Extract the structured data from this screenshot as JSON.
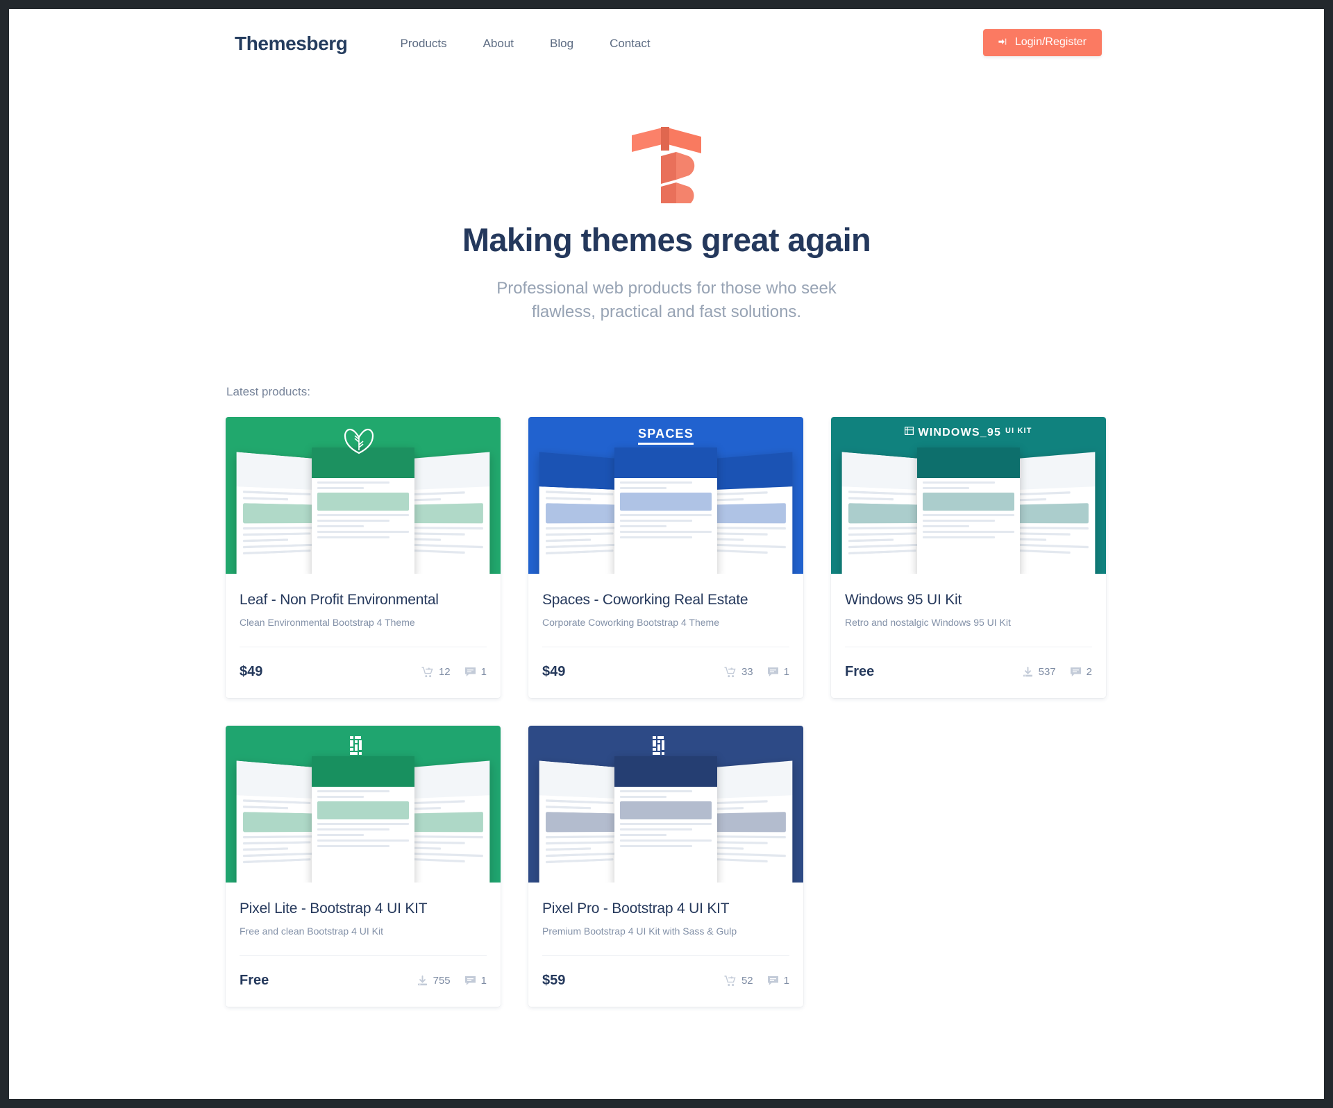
{
  "theme": {
    "accent": "#fb7a62",
    "navy": "#24385c",
    "muted": "#97a3b4",
    "page_border": "#23282d"
  },
  "navbar": {
    "brand": "Themesberg",
    "links": [
      {
        "label": "Products"
      },
      {
        "label": "About"
      },
      {
        "label": "Blog"
      },
      {
        "label": "Contact"
      }
    ],
    "login_label": "Login/Register",
    "login_icon": "sign-in-icon"
  },
  "hero": {
    "logo_icon": "themesberg-logo-mark",
    "title": "Making themes great again",
    "subtitle_line1": "Professional web products for those who seek",
    "subtitle_line2": "flawless, practical and fast solutions."
  },
  "products": {
    "section_label": "Latest products:",
    "items": [
      {
        "title": "Leaf - Non Profit Environmental",
        "description": "Clean Environmental Bootstrap 4 Theme",
        "price": "$49",
        "count_icon": "cart-icon",
        "count_value": "12",
        "comments_icon": "comment-icon",
        "comments_value": "1",
        "thumb_label": "",
        "thumb_logo_icon": "leaf-icon",
        "thumb_bg": "#21a86d",
        "thumb_accent": "#1c9160"
      },
      {
        "title": "Spaces - Coworking Real Estate",
        "description": "Corporate Coworking Bootstrap 4 Theme",
        "price": "$49",
        "count_icon": "cart-icon",
        "count_value": "33",
        "comments_icon": "comment-icon",
        "comments_value": "1",
        "thumb_label": "SPACES",
        "thumb_logo_icon": "",
        "thumb_bg": "#2162cf",
        "thumb_accent": "#1b53b4"
      },
      {
        "title": "Windows 95 UI Kit",
        "description": "Retro and nostalgic Windows 95 UI Kit",
        "price": "Free",
        "count_icon": "download-icon",
        "count_value": "537",
        "comments_icon": "comment-icon",
        "comments_value": "2",
        "thumb_label": "WINDOWS_95",
        "thumb_label_sup": "UI KIT",
        "thumb_logo_icon": "window-icon",
        "thumb_bg": "#10827e",
        "thumb_accent": "#0d6f6c"
      },
      {
        "title": "Pixel Lite - Bootstrap 4 UI KIT",
        "description": "Free and clean Bootstrap 4 UI Kit",
        "price": "Free",
        "count_icon": "download-icon",
        "count_value": "755",
        "comments_icon": "comment-icon",
        "comments_value": "1",
        "thumb_label": "",
        "thumb_logo_icon": "pixel-icon",
        "thumb_bg": "#1fa56f",
        "thumb_accent": "#18905f"
      },
      {
        "title": "Pixel Pro - Bootstrap 4 UI KIT",
        "description": "Premium Bootstrap 4 UI Kit with Sass & Gulp",
        "price": "$59",
        "count_icon": "cart-icon",
        "count_value": "52",
        "comments_icon": "comment-icon",
        "comments_value": "1",
        "thumb_label": "",
        "thumb_logo_icon": "pixel-icon",
        "thumb_bg": "#2d4a86",
        "thumb_accent": "#253e72"
      }
    ]
  }
}
